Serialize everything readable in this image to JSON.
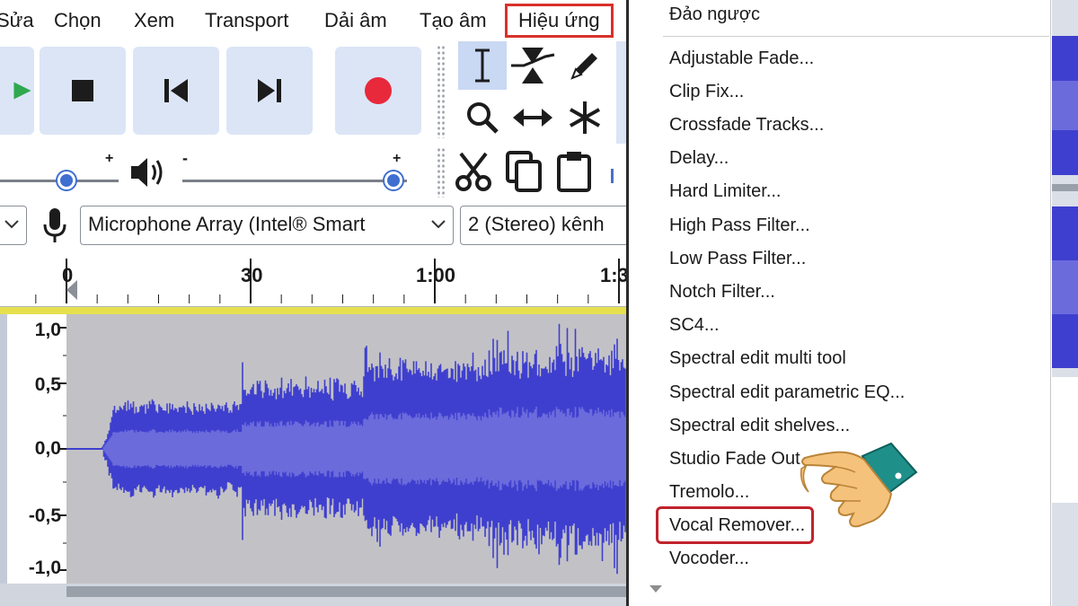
{
  "menubar": {
    "items": [
      {
        "label": "Sửa"
      },
      {
        "label": "Chọn"
      },
      {
        "label": "Xem"
      },
      {
        "label": "Transport"
      },
      {
        "label": "Dải âm"
      },
      {
        "label": "Tạo âm"
      },
      {
        "label": "Hiệu ứng"
      }
    ]
  },
  "transport": {
    "buttons": [
      "play-button",
      "stop-button",
      "skip-to-start-button",
      "skip-to-end-button",
      "record-button"
    ],
    "record_color": "#e8293b"
  },
  "tools": [
    "selection-tool-icon",
    "envelope-tool-icon",
    "draw-tool-icon",
    "zoom-tool-icon",
    "time-shift-tool-icon",
    "multi-tool-icon"
  ],
  "edit": [
    "cut-icon",
    "copy-icon",
    "paste-icon"
  ],
  "meters": {
    "playback_minus": "-",
    "playback_plus": "+",
    "recording_minus": "-",
    "recording_plus": "+",
    "playback_level": 0.56,
    "recording_level": 0.94
  },
  "devices": {
    "input_device": "Microphone Array (Intel® Smart",
    "channels": "2 (Stereo) kênh"
  },
  "timeline": {
    "ticks": [
      {
        "label": "0"
      },
      {
        "label": "30"
      },
      {
        "label": "1:00"
      },
      {
        "label": "1:3"
      }
    ]
  },
  "track": {
    "yaxis": [
      {
        "label": "1,0"
      },
      {
        "label": "0,5"
      },
      {
        "label": "0,0"
      },
      {
        "label": "-0,5"
      },
      {
        "label": "-1,0"
      }
    ],
    "wave_color": "#3f3fcf",
    "rms_color": "#6b6bdc"
  },
  "dropdown": {
    "items": [
      {
        "label": "Đảo ngược"
      },
      {
        "label": "Adjustable Fade..."
      },
      {
        "label": "Clip Fix..."
      },
      {
        "label": "Crossfade Tracks..."
      },
      {
        "label": "Delay..."
      },
      {
        "label": "Hard Limiter..."
      },
      {
        "label": "High Pass Filter..."
      },
      {
        "label": "Low Pass Filter..."
      },
      {
        "label": "Notch Filter..."
      },
      {
        "label": "SC4..."
      },
      {
        "label": "Spectral edit multi tool"
      },
      {
        "label": "Spectral edit parametric EQ..."
      },
      {
        "label": "Spectral edit shelves..."
      },
      {
        "label": "Studio Fade Out"
      },
      {
        "label": "Tremolo..."
      },
      {
        "label": "Vocal Remover..."
      },
      {
        "label": "Vocoder..."
      }
    ],
    "highlighted_item": "Vocal Remover...",
    "highlight_color": "#c1232c"
  },
  "pointer": {
    "icon": "pointing-hand-icon"
  }
}
